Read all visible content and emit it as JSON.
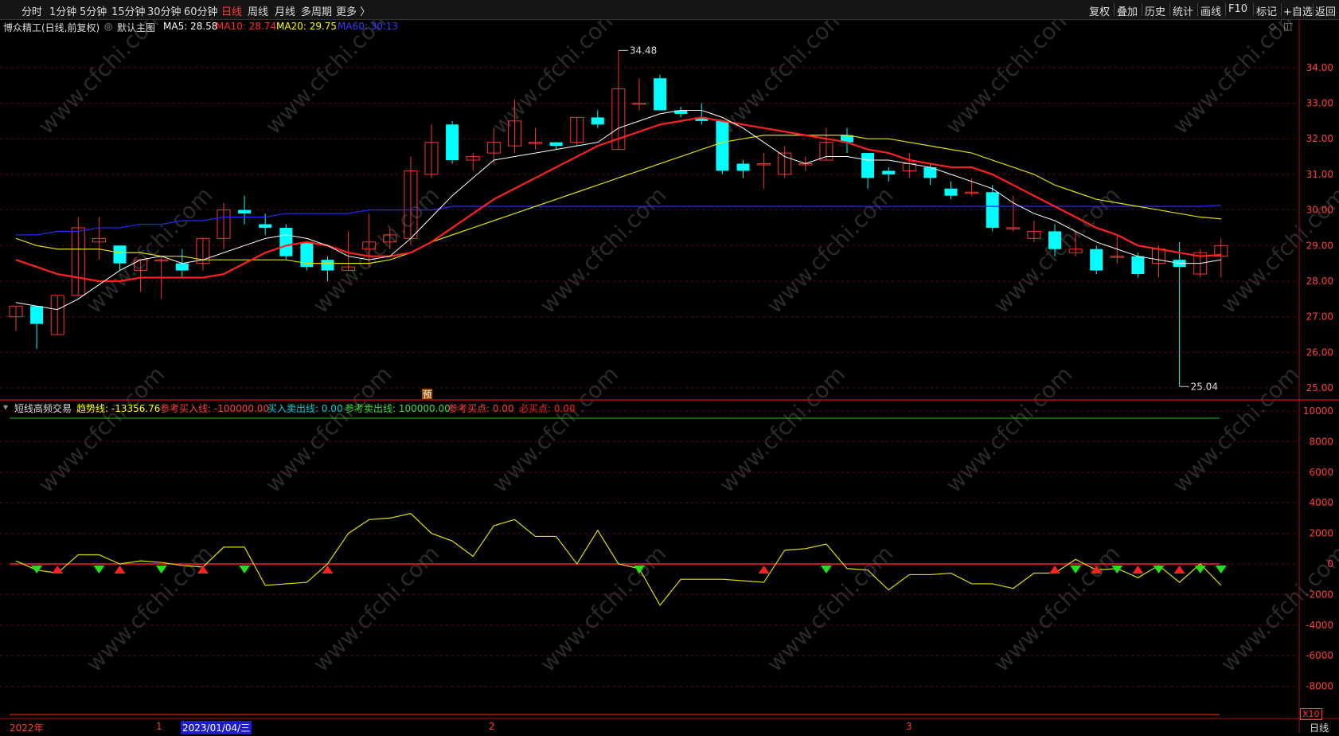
{
  "toolbar": {
    "periods": [
      "分时",
      "1分钟",
      "5分钟",
      "15分钟",
      "30分钟",
      "60分钟",
      "日线",
      "周线",
      "月线",
      "多周期",
      "更多 〉"
    ],
    "active_period": "日线",
    "right_buttons": [
      "复权",
      "叠加",
      "历史",
      "统计",
      "画线",
      "F10",
      "标记",
      "+自选",
      "返回"
    ]
  },
  "main_chart": {
    "stock_title": "博众精工(日线,前复权)",
    "template": "默认主图",
    "ma_labels": [
      {
        "text": "MA5: 28.58",
        "color": "#ffffff"
      },
      {
        "text": "MA10: 28.74",
        "color": "#ff2a2a"
      },
      {
        "text": "MA20: 29.75",
        "color": "#ffff00"
      },
      {
        "text": "MA60: 30.13",
        "color": "#3a3aff"
      }
    ],
    "high_label": "34.48",
    "low_label": "25.04",
    "y_ticks": [
      "34.00",
      "33.00",
      "32.00",
      "31.00",
      "30.00",
      "29.00",
      "28.00",
      "27.00",
      "26.00",
      "25.00"
    ],
    "yu_marker": "预"
  },
  "indicator": {
    "name": "短线高频交易",
    "values": [
      {
        "text": "趋势线: -13356.76",
        "color": "#ffff00"
      },
      {
        "text": "参考买入线: -100000.00",
        "color": "#ff4040"
      },
      {
        "text": "买入卖出线: 0.00",
        "color": "#00d0d0"
      },
      {
        "text": "参考卖出线: 100000.00",
        "color": "#40e040"
      },
      {
        "text": "参考买点: 0.00",
        "color": "#ff4040"
      },
      {
        "text": "必买点: 0.00",
        "color": "#ff2020"
      }
    ],
    "y_ticks": [
      "10000",
      "8000",
      "6000",
      "4000",
      "2000",
      "0",
      "-2000",
      "-4000",
      "-6000",
      "-8000"
    ]
  },
  "bottom_bar": {
    "year_label": "2022年",
    "month_1": "1",
    "date_highlight": "2023/01/04/三",
    "month_2": "2",
    "month_3": "3",
    "period_label": "日线",
    "zoom_label": "X10"
  },
  "watermark": "www.cfchi.com",
  "chart_data": {
    "type": "candlestick",
    "candles": [
      [
        27.0,
        27.3,
        26.6,
        27.3
      ],
      [
        27.3,
        26.8,
        26.1,
        27.3
      ],
      [
        26.5,
        27.6,
        26.5,
        27.6
      ],
      [
        27.6,
        29.5,
        27.6,
        29.8
      ],
      [
        29.1,
        29.2,
        28.6,
        29.8
      ],
      [
        29.0,
        28.5,
        28.3,
        29.0
      ],
      [
        28.3,
        28.6,
        27.7,
        28.6
      ],
      [
        28.6,
        28.6,
        27.5,
        28.7
      ],
      [
        28.5,
        28.3,
        28.1,
        28.9
      ],
      [
        28.5,
        29.2,
        28.3,
        29.2
      ],
      [
        29.2,
        30.0,
        28.9,
        30.2
      ],
      [
        30.0,
        29.9,
        29.6,
        30.4
      ],
      [
        29.6,
        29.5,
        29.3,
        29.9
      ],
      [
        29.5,
        28.7,
        28.6,
        29.6
      ],
      [
        29.1,
        28.4,
        28.3,
        29.1
      ],
      [
        28.6,
        28.3,
        28.0,
        28.7
      ],
      [
        28.3,
        28.4,
        28.3,
        29.4
      ],
      [
        28.9,
        29.1,
        28.4,
        29.9
      ],
      [
        29.1,
        29.3,
        28.9,
        29.5
      ],
      [
        29.2,
        31.1,
        29.0,
        31.5
      ],
      [
        31.0,
        31.9,
        30.9,
        32.4
      ],
      [
        32.4,
        31.4,
        31.3,
        32.5
      ],
      [
        31.4,
        31.5,
        31.1,
        31.6
      ],
      [
        31.6,
        31.9,
        31.3,
        32.3
      ],
      [
        31.8,
        32.5,
        31.6,
        33.1
      ],
      [
        31.9,
        31.9,
        31.7,
        32.3
      ],
      [
        31.9,
        31.8,
        31.7,
        31.9
      ],
      [
        31.9,
        32.6,
        31.8,
        32.6
      ],
      [
        32.6,
        32.4,
        32.3,
        32.8
      ],
      [
        31.7,
        33.4,
        31.7,
        34.48
      ],
      [
        33.0,
        33.0,
        32.8,
        33.7
      ],
      [
        33.7,
        32.8,
        32.8,
        33.8
      ],
      [
        32.8,
        32.7,
        32.6,
        32.9
      ],
      [
        32.6,
        32.5,
        32.4,
        33.0
      ],
      [
        32.5,
        31.1,
        31.0,
        32.5
      ],
      [
        31.3,
        31.1,
        30.9,
        31.4
      ],
      [
        31.3,
        31.3,
        30.6,
        31.6
      ],
      [
        31.0,
        31.6,
        30.9,
        31.8
      ],
      [
        31.3,
        31.3,
        31.1,
        31.5
      ],
      [
        31.4,
        31.9,
        31.4,
        32.3
      ],
      [
        32.1,
        31.9,
        31.6,
        32.3
      ],
      [
        31.6,
        30.9,
        30.6,
        31.6
      ],
      [
        31.1,
        31.0,
        30.8,
        31.2
      ],
      [
        31.1,
        31.3,
        30.9,
        31.6
      ],
      [
        31.2,
        30.9,
        30.7,
        31.3
      ],
      [
        30.6,
        30.4,
        30.3,
        30.8
      ],
      [
        30.5,
        30.5,
        30.4,
        30.9
      ],
      [
        30.5,
        29.5,
        29.4,
        30.7
      ],
      [
        29.5,
        29.5,
        29.4,
        30.4
      ],
      [
        29.2,
        29.4,
        29.1,
        29.7
      ],
      [
        29.4,
        28.9,
        28.7,
        29.6
      ],
      [
        28.8,
        28.9,
        28.7,
        29.4
      ],
      [
        28.9,
        28.3,
        28.2,
        29.0
      ],
      [
        28.7,
        28.7,
        28.5,
        29.3
      ],
      [
        28.7,
        28.2,
        28.1,
        28.8
      ],
      [
        28.5,
        28.9,
        28.1,
        29.0
      ],
      [
        28.6,
        28.4,
        25.04,
        29.1
      ],
      [
        28.2,
        28.8,
        28.1,
        28.9
      ],
      [
        28.7,
        29.0,
        28.1,
        29.2
      ]
    ],
    "ma5": [
      27.4,
      27.3,
      27.2,
      27.5,
      27.9,
      28.3,
      28.6,
      28.7,
      28.5,
      28.6,
      28.8,
      29.0,
      29.2,
      29.3,
      29.2,
      29.0,
      28.7,
      28.6,
      28.7,
      29.2,
      29.8,
      30.4,
      30.9,
      31.4,
      31.5,
      31.6,
      31.7,
      31.8,
      31.9,
      32.3,
      32.5,
      32.7,
      32.8,
      32.8,
      32.6,
      32.3,
      31.9,
      31.5,
      31.3,
      31.5,
      31.5,
      31.4,
      31.4,
      31.3,
      31.2,
      31.0,
      30.8,
      30.6,
      30.2,
      29.9,
      29.7,
      29.4,
      29.1,
      28.9,
      28.7,
      28.6,
      28.5,
      28.5,
      28.6
    ],
    "ma10": [
      28.6,
      28.4,
      28.2,
      28.1,
      28.0,
      28.0,
      28.1,
      28.1,
      28.1,
      28.1,
      28.2,
      28.5,
      28.8,
      29.0,
      29.1,
      29.0,
      28.8,
      28.7,
      28.7,
      28.8,
      29.1,
      29.5,
      29.9,
      30.3,
      30.6,
      30.9,
      31.2,
      31.5,
      31.8,
      32.0,
      32.2,
      32.4,
      32.5,
      32.6,
      32.5,
      32.4,
      32.3,
      32.2,
      32.1,
      32.0,
      31.9,
      31.7,
      31.6,
      31.4,
      31.3,
      31.2,
      31.2,
      31.0,
      30.7,
      30.4,
      30.1,
      29.8,
      29.5,
      29.3,
      29.0,
      28.9,
      28.8,
      28.7,
      28.74
    ],
    "ma20": [
      29.2,
      29.0,
      28.9,
      28.9,
      28.9,
      28.8,
      28.8,
      28.7,
      28.7,
      28.6,
      28.6,
      28.6,
      28.6,
      28.6,
      28.5,
      28.5,
      28.5,
      28.5,
      28.6,
      28.8,
      29.1,
      29.3,
      29.5,
      29.7,
      29.9,
      30.1,
      30.3,
      30.5,
      30.7,
      30.9,
      31.1,
      31.3,
      31.5,
      31.7,
      31.9,
      32.0,
      32.1,
      32.1,
      32.1,
      32.1,
      32.1,
      32.0,
      32.0,
      31.9,
      31.8,
      31.7,
      31.6,
      31.4,
      31.2,
      31.0,
      30.7,
      30.5,
      30.3,
      30.2,
      30.1,
      30.0,
      29.9,
      29.8,
      29.75
    ],
    "ma60": [
      29.3,
      29.3,
      29.4,
      29.4,
      29.5,
      29.5,
      29.6,
      29.6,
      29.7,
      29.7,
      29.8,
      29.8,
      29.8,
      29.9,
      29.9,
      29.9,
      29.9,
      30.0,
      30.0,
      30.0,
      30.0,
      30.1,
      30.1,
      30.1,
      30.1,
      30.1,
      30.1,
      30.1,
      30.1,
      30.1,
      30.1,
      30.1,
      30.1,
      30.1,
      30.1,
      30.1,
      30.1,
      30.1,
      30.1,
      30.1,
      30.1,
      30.1,
      30.1,
      30.1,
      30.1,
      30.1,
      30.1,
      30.1,
      30.1,
      30.1,
      30.1,
      30.1,
      30.1,
      30.1,
      30.1,
      30.1,
      30.1,
      30.1,
      30.13
    ],
    "trend_line": [
      200,
      -400,
      -600,
      600,
      600,
      0,
      200,
      100,
      -100,
      -200,
      1100,
      1100,
      -1400,
      -1300,
      -1200,
      0,
      2000,
      2900,
      3000,
      3300,
      2000,
      1500,
      500,
      2500,
      2900,
      1800,
      1800,
      0,
      2200,
      0,
      -300,
      -2700,
      -1000,
      -1000,
      -1000,
      -1100,
      -1200,
      900,
      1000,
      1300,
      -300,
      -400,
      -1700,
      -700,
      -700,
      -600,
      -1300,
      -1300,
      -1600,
      -600,
      -600,
      300,
      -400,
      -300,
      -900,
      -100,
      -1200,
      0,
      -1400
    ],
    "buy_markers": [
      2,
      5,
      9,
      15,
      36,
      50,
      52,
      54,
      56
    ],
    "sell_markers": [
      1,
      4,
      7,
      11,
      30,
      39,
      51,
      53,
      55,
      57,
      58
    ],
    "price_ylim": [
      24.8,
      34.6
    ],
    "indicator_ylim": [
      -10000,
      10000
    ]
  }
}
